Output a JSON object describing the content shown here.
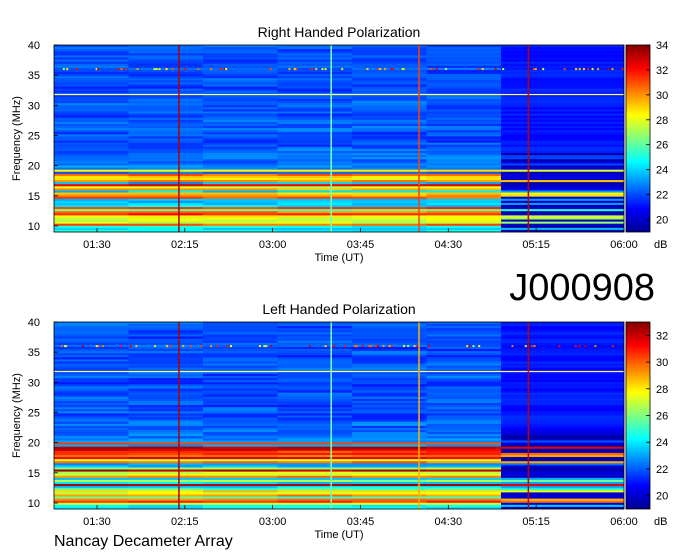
{
  "observation_id": "J000908",
  "credit": "Nancay Decameter Array",
  "colors": {
    "colormap": [
      "#00008f",
      "#0000ff",
      "#0080ff",
      "#00ffff",
      "#80ff80",
      "#ffff00",
      "#ff8000",
      "#ff0000",
      "#800000"
    ],
    "background": "#ffffff"
  },
  "chart_data": [
    {
      "type": "heatmap",
      "title": "Right Handed Polarization",
      "xlabel": "Time (UT)",
      "ylabel": "Frequency (MHz)",
      "colorbar_label": "dB",
      "x_ticks": [
        "01:30",
        "02:15",
        "03:00",
        "03:45",
        "04:30",
        "05:15",
        "06:00"
      ],
      "xlim": [
        "01:08",
        "06:00"
      ],
      "y_ticks": [
        10,
        15,
        20,
        25,
        30,
        35,
        40
      ],
      "ylim": [
        9,
        40
      ],
      "colorbar_ticks": [
        20,
        22,
        24,
        26,
        28,
        30,
        32,
        34
      ],
      "color_range": [
        19,
        34
      ],
      "vertical_lines": [
        {
          "time": "02:12",
          "color": "#b00000"
        },
        {
          "time": "03:30",
          "color": "#80ffb0"
        },
        {
          "time": "04:15",
          "color": "#ff4000"
        },
        {
          "time": "05:11",
          "color": "#c00000"
        }
      ],
      "horizontal_lines": [
        {
          "freq": 31.8,
          "color": "#ffff80"
        }
      ],
      "darker_region_after": "04:57",
      "emission_bands_MHz": [
        [
          10,
          12.5
        ],
        [
          14.5,
          15.5
        ],
        [
          17.5,
          18.5
        ]
      ]
    },
    {
      "type": "heatmap",
      "title": "Left Handed Polarization",
      "xlabel": "Time (UT)",
      "ylabel": "Frequency (MHz)",
      "colorbar_label": "dB",
      "x_ticks": [
        "01:30",
        "02:15",
        "03:00",
        "03:45",
        "04:30",
        "05:15",
        "06:00"
      ],
      "xlim": [
        "01:08",
        "06:00"
      ],
      "y_ticks": [
        10,
        15,
        20,
        25,
        30,
        35,
        40
      ],
      "ylim": [
        9,
        40
      ],
      "colorbar_ticks": [
        20,
        22,
        24,
        26,
        28,
        30,
        32
      ],
      "color_range": [
        19,
        33
      ],
      "vertical_lines": [
        {
          "time": "02:12",
          "color": "#b00000"
        },
        {
          "time": "03:30",
          "color": "#80ffb0"
        },
        {
          "time": "04:15",
          "color": "#ffb000"
        },
        {
          "time": "05:11",
          "color": "#c00000"
        }
      ],
      "horizontal_lines": [
        {
          "freq": 31.8,
          "color": "#ffff80"
        }
      ],
      "darker_region_after": "04:57",
      "emission_bands_MHz": [
        [
          10,
          12.5
        ],
        [
          14.5,
          15.5
        ],
        [
          17.5,
          18.5
        ]
      ]
    }
  ]
}
